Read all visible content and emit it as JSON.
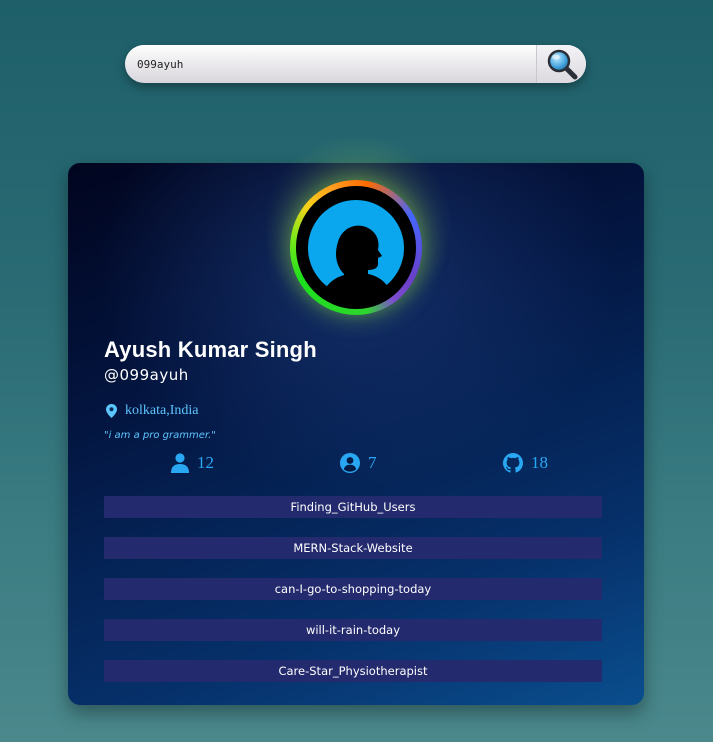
{
  "search": {
    "value": "099ayuh",
    "button_icon": "search-icon"
  },
  "profile": {
    "name": "Ayush Kumar Singh",
    "handle": "@099ayuh",
    "location": "kolkata,India",
    "bio": "\"i am a pro grammer.\"",
    "avatar_ring_colors": [
      "#ff9a1f",
      "#4466ff",
      "#7d4fcf",
      "#1ce01c",
      "#f7d21a"
    ],
    "accent_color": "#29a7f2"
  },
  "stats": {
    "followers": {
      "icon": "user-icon",
      "value": "12"
    },
    "following": {
      "icon": "user-circle-icon",
      "value": "7"
    },
    "repos": {
      "icon": "github-icon",
      "value": "18"
    }
  },
  "repos": [
    {
      "name": "Finding_GitHub_Users"
    },
    {
      "name": "MERN-Stack-Website"
    },
    {
      "name": "can-I-go-to-shopping-today"
    },
    {
      "name": "will-it-rain-today"
    },
    {
      "name": "Care-Star_Physiotherapist"
    }
  ]
}
